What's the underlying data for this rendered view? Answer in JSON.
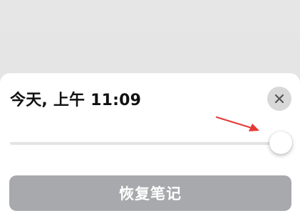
{
  "sheet": {
    "title": "今天, 上午 11:09",
    "close_icon": "close-icon",
    "slider": {
      "value_percent": 100
    },
    "restore_button_label": "恢复笔记"
  },
  "colors": {
    "backdrop": "#e4e4e4",
    "sheet": "#ffffff",
    "close_button_bg": "#d8d8d8",
    "restore_button_bg": "#a7a9ac",
    "annotation_arrow": "#e53935"
  }
}
